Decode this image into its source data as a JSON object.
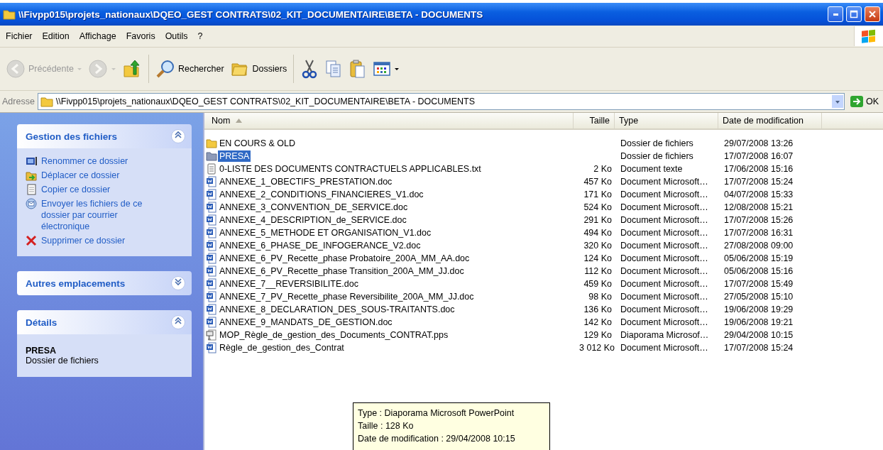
{
  "window": {
    "title": "\\\\Fivpp015\\projets_nationaux\\DQEO_GEST CONTRATS\\02_KIT_DOCUMENTAIRE\\BETA - DOCUMENTS"
  },
  "menu": [
    {
      "label": "Fichier"
    },
    {
      "label": "Edition"
    },
    {
      "label": "Affichage"
    },
    {
      "label": "Favoris"
    },
    {
      "label": "Outils"
    },
    {
      "label": "?"
    }
  ],
  "toolbar": {
    "buttons": [
      {
        "kind": "back",
        "label": "Précédente",
        "disabled": true,
        "dropdown": true
      },
      {
        "kind": "forward",
        "disabled": true,
        "dropdown": true
      },
      {
        "kind": "up",
        "disabled": false
      },
      {
        "kind": "search",
        "label": "Rechercher",
        "disabled": false
      },
      {
        "kind": "folders",
        "label": "Dossiers",
        "disabled": false
      },
      {
        "kind": "cut",
        "disabled": false
      },
      {
        "kind": "copy",
        "disabled": false
      },
      {
        "kind": "paste",
        "disabled": false
      },
      {
        "kind": "views",
        "disabled": false,
        "dropdown": true
      }
    ]
  },
  "address": {
    "label": "Adresse",
    "value": "\\\\Fivpp015\\projets_nationaux\\DQEO_GEST CONTRATS\\02_KIT_DOCUMENTAIRE\\BETA - DOCUMENTS",
    "go": "OK"
  },
  "sidebar": {
    "panels": [
      {
        "title": "Gestion des fichiers",
        "expanded": true,
        "items": [
          {
            "kind": "rename",
            "label": "Renommer ce dossier"
          },
          {
            "kind": "move",
            "label": "Déplacer ce dossier"
          },
          {
            "kind": "copy",
            "label": "Copier ce dossier"
          },
          {
            "kind": "email",
            "label": "Envoyer les fichiers de ce dossier par courrier électronique"
          },
          {
            "kind": "delete",
            "label": "Supprimer ce dossier"
          }
        ]
      },
      {
        "title": "Autres emplacements",
        "expanded": false
      },
      {
        "title": "Détails",
        "expanded": true,
        "details": {
          "name": "PRESA",
          "type": "Dossier de fichiers"
        }
      }
    ]
  },
  "file_list": {
    "columns": [
      {
        "label": "Nom",
        "sorted": true
      },
      {
        "label": "Taille",
        "sorted": false
      },
      {
        "label": "Type",
        "sorted": false
      },
      {
        "label": "Date de modification",
        "sorted": false
      }
    ],
    "rows": [
      {
        "kind": "folder",
        "name": "EN COURS & OLD",
        "type": "Dossier de fichiers",
        "modified": "29/07/2008 13:26",
        "selected": false
      },
      {
        "kind": "folder",
        "name": "PRESA",
        "type": "Dossier de fichiers",
        "modified": "17/07/2008 16:07",
        "selected": true
      },
      {
        "kind": "text",
        "name": "0-LISTE DES DOCUMENTS CONTRACTUELS APPLICABLES.txt",
        "size": "2 Ko",
        "type": "Document texte",
        "modified": "17/06/2008 15:16",
        "selected": false
      },
      {
        "kind": "word",
        "name": "ANNEXE_1_OBECTIFS_PRESTATION.doc",
        "size": "457 Ko",
        "type": "Document Microsoft…",
        "modified": "17/07/2008 15:24",
        "selected": false
      },
      {
        "kind": "word",
        "name": "ANNEXE_2_CONDITIONS_FINANCIERES_V1.doc",
        "size": "171 Ko",
        "type": "Document Microsoft…",
        "modified": "04/07/2008 15:33",
        "selected": false
      },
      {
        "kind": "word",
        "name": "ANNEXE_3_CONVENTION_DE_SERVICE.doc",
        "size": "524 Ko",
        "type": "Document Microsoft…",
        "modified": "12/08/2008 15:21",
        "selected": false
      },
      {
        "kind": "word",
        "name": "ANNEXE_4_DESCRIPTION_de_SERVICE.doc",
        "size": "291 Ko",
        "type": "Document Microsoft…",
        "modified": "17/07/2008 15:26",
        "selected": false
      },
      {
        "kind": "word",
        "name": "ANNEXE_5_METHODE ET ORGANISATION_V1.doc",
        "size": "494 Ko",
        "type": "Document Microsoft…",
        "modified": "17/07/2008 16:31",
        "selected": false
      },
      {
        "kind": "word",
        "name": "ANNEXE_6_PHASE_DE_INFOGERANCE_V2.doc",
        "size": "320 Ko",
        "type": "Document Microsoft…",
        "modified": "27/08/2008 09:00",
        "selected": false
      },
      {
        "kind": "word",
        "name": "ANNEXE_6_PV_Recette_phase Probatoire_200A_MM_AA.doc",
        "size": "124 Ko",
        "type": "Document Microsoft…",
        "modified": "05/06/2008 15:19",
        "selected": false
      },
      {
        "kind": "word",
        "name": "ANNEXE_6_PV_Recette_phase Transition_200A_MM_JJ.doc",
        "size": "112 Ko",
        "type": "Document Microsoft…",
        "modified": "05/06/2008 15:16",
        "selected": false
      },
      {
        "kind": "word",
        "name": "ANNEXE_7__REVERSIBILITE.doc",
        "size": "459 Ko",
        "type": "Document Microsoft…",
        "modified": "17/07/2008 15:49",
        "selected": false
      },
      {
        "kind": "word",
        "name": "ANNEXE_7_PV_Recette_phase Reversibilite_200A_MM_JJ.doc",
        "size": "98 Ko",
        "type": "Document Microsoft…",
        "modified": "27/05/2008 15:10",
        "selected": false
      },
      {
        "kind": "word",
        "name": "ANNEXE_8_DECLARATION_DES_SOUS-TRAITANTS.doc",
        "size": "136 Ko",
        "type": "Document Microsoft…",
        "modified": "19/06/2008 19:29",
        "selected": false
      },
      {
        "kind": "word",
        "name": "ANNEXE_9_MANDATS_DE_GESTION.doc",
        "size": "142 Ko",
        "type": "Document Microsoft…",
        "modified": "19/06/2008 19:21",
        "selected": false
      },
      {
        "kind": "slideshow",
        "name": "MOP_Règle_de_gestion_des_Documents_CONTRAT.pps",
        "size": "129 Ko",
        "type": "Diaporama Microsof…",
        "modified": "29/04/2008 10:15",
        "selected": false
      },
      {
        "kind": "word",
        "name": "Règle_de_gestion_des_Contrat",
        "size": "3 012 Ko",
        "type": "Document Microsoft…",
        "modified": "17/07/2008 15:24",
        "selected": false
      }
    ]
  },
  "tooltip": {
    "lines": [
      "Type : Diaporama Microsoft PowerPoint",
      "Taille  : 128 Ko",
      "Date de modification : 29/04/2008 10:15"
    ]
  }
}
